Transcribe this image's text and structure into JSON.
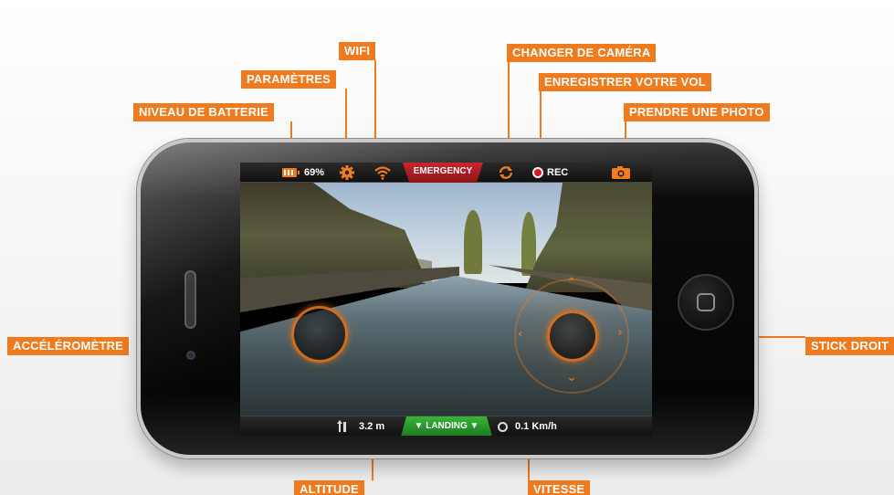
{
  "callouts": {
    "wifi": "WIFI",
    "parametres": "PARAMÈTRES",
    "batterie": "NIVEAU DE BATTERIE",
    "changer_camera": "CHANGER DE CAMÉRA",
    "enregistrer": "ENREGISTRER VOTRE VOL",
    "photo": "PRENDRE UNE PHOTO",
    "accelerometre": "ACCÉLÉROMÈTRE",
    "stick_droit": "STICK DROIT",
    "altitude": "ALTITUDE",
    "vitesse": "VITESSE"
  },
  "topbar": {
    "battery_value": "69%",
    "emergency_label": "EMERGENCY",
    "rec_label": "REC"
  },
  "bottombar": {
    "altitude_value": "3.2 m",
    "landing_label": "LANDING",
    "speed_value": "0.1 Km/h"
  },
  "colors": {
    "accent": "#f07a1e",
    "emergency": "#c9262c",
    "landing": "#39b43a",
    "rec": "#e0141b"
  },
  "icons": [
    "battery-icon",
    "gear-icon",
    "wifi-icon",
    "switch-camera-icon",
    "record-icon",
    "camera-icon",
    "altitude-icon",
    "speed-icon"
  ]
}
